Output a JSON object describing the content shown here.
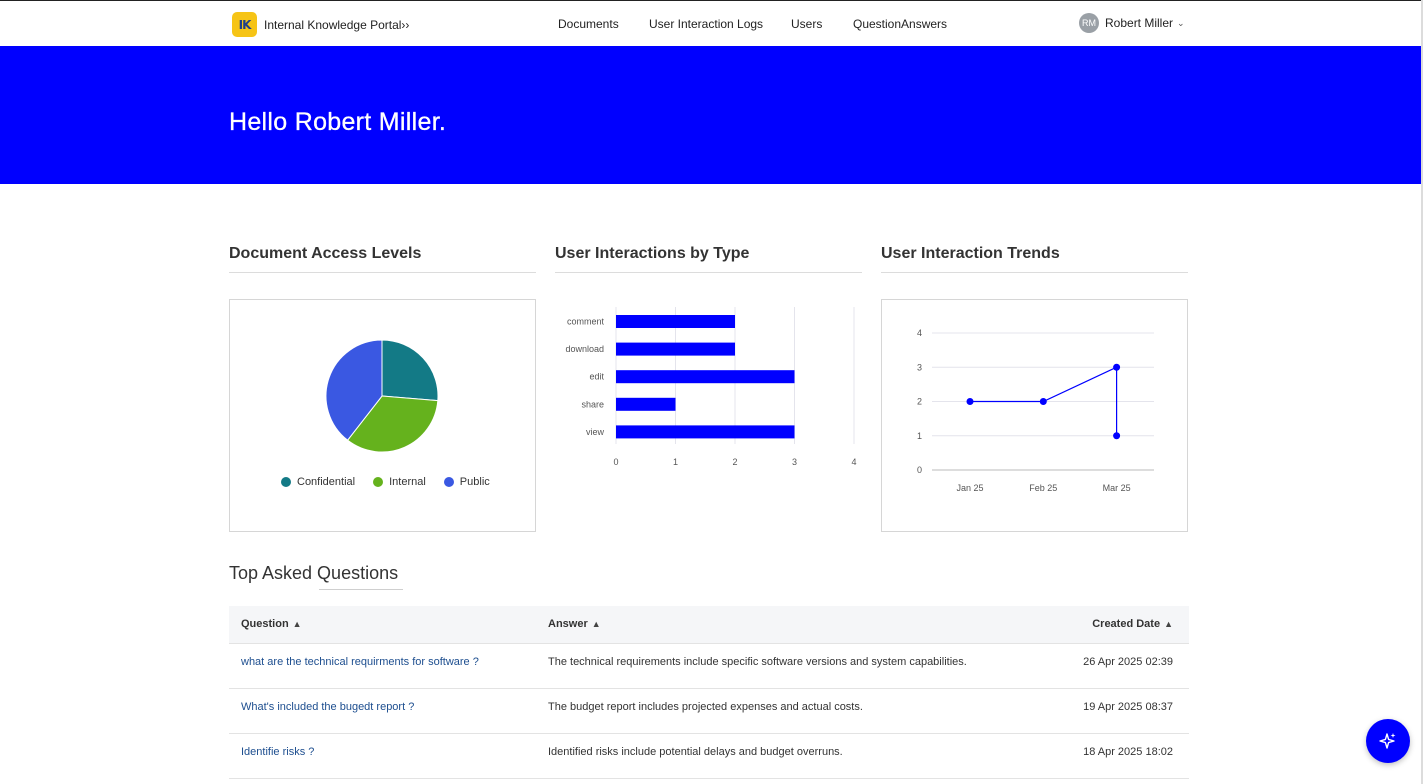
{
  "header": {
    "logo_text": "IK",
    "brand": "Internal Knowledge Portal››",
    "nav": [
      "Documents",
      "User Interaction Logs",
      "Users",
      "QuestionAnswers"
    ],
    "user_initials": "RM",
    "user_name": "Robert Miller"
  },
  "hero": {
    "greeting": "Hello Robert Miller."
  },
  "sections": {
    "access": "Document Access Levels",
    "by_type": "User Interactions by Type",
    "trends": "User Interaction Trends"
  },
  "chart_data": [
    {
      "type": "pie",
      "title": "Document Access Levels",
      "labels": [
        "Confidential",
        "Internal",
        "Public"
      ],
      "values": [
        1,
        1.3,
        1.5
      ],
      "colors": [
        "#137a86",
        "#65b21d",
        "#3a58e2"
      ]
    },
    {
      "type": "bar",
      "orientation": "horizontal",
      "title": "User Interactions by Type",
      "categories": [
        "comment",
        "download",
        "edit",
        "share",
        "view"
      ],
      "values": [
        2,
        2,
        3,
        1,
        3
      ],
      "xlim": [
        0,
        4
      ],
      "xticks": [
        "0",
        "1",
        "2",
        "3",
        "4"
      ],
      "color": "#0000ff"
    },
    {
      "type": "line",
      "title": "User Interaction Trends",
      "x_labels": [
        "Jan 25",
        "Feb 25",
        "Mar 25"
      ],
      "points": [
        {
          "x": "Jan 25",
          "y": 2
        },
        {
          "x": "Feb 25",
          "y": 2
        },
        {
          "x": "Mar 25",
          "y": 3
        },
        {
          "x": "Mar 25",
          "y": 1
        }
      ],
      "ylim": [
        0,
        4
      ],
      "yticks": [
        "0",
        "1",
        "2",
        "3",
        "4"
      ],
      "color": "#0000ff"
    }
  ],
  "questions": {
    "title": "Top Asked Questions",
    "columns": [
      "Question",
      "Answer",
      "Created Date"
    ],
    "rows": [
      {
        "question": "what are the technical requirments for software ?",
        "answer": "The technical requirements include specific software versions and system capabilities.",
        "date": "26 Apr 2025 02:39"
      },
      {
        "question": "What's included the bugedt report ?",
        "answer": "The budget report includes projected expenses and actual costs.",
        "date": "19 Apr 2025 08:37"
      },
      {
        "question": "Identifie risks ?",
        "answer": "Identified risks include potential delays and budget overruns.",
        "date": "18 Apr 2025 18:02"
      }
    ]
  },
  "colors": {
    "primary": "#0000ff",
    "logo": "#f6c416",
    "link": "#1d4e8f"
  },
  "icons": {
    "fab": "sparkle-icon",
    "user_menu": "chevron-down-icon"
  }
}
